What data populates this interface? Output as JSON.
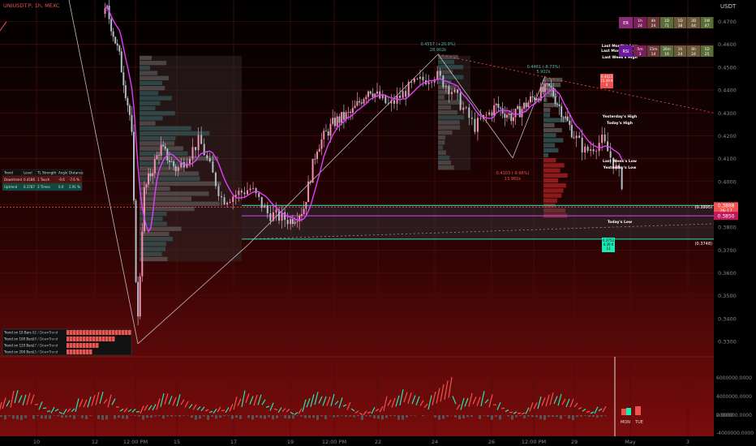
{
  "header": {
    "symbol": "UNIUSDT.P, 1h, MEXC"
  },
  "price_axis": {
    "currency": "USDT",
    "ticks": [
      "0.4700",
      "0.4600",
      "0.4500",
      "0.4400",
      "0.4300",
      "0.4200",
      "0.4100",
      "0.4000",
      "0.3900",
      "0.3800",
      "0.3700",
      "0.3600",
      "0.3500",
      "0.3400",
      "0.3300"
    ],
    "current_price": "0.3888",
    "countdown": "26:17",
    "marker_price": "0.3850"
  },
  "volume_axis": {
    "ticks": [
      "6000000.0000",
      "4000000.0000",
      "2000000.0000",
      "0.0000",
      "-4000000.0000"
    ]
  },
  "time_axis": {
    "labels": [
      "10",
      "12",
      "12:00 PM",
      "15",
      "17",
      "19",
      "12:00 PM",
      "22",
      "24",
      "26",
      "12:00 PM",
      "29",
      "May",
      "3"
    ]
  },
  "tf_tables": {
    "trend_row": {
      "label": "ER",
      "cells": [
        "1h 24",
        "4h 24",
        "1D 71",
        "1D 38",
        "3D 44",
        "1W 47"
      ]
    },
    "rsi_row": {
      "label": "RSI",
      "cells": [
        "5m 3",
        "15m 14",
        "30m 16",
        "1h 24",
        "4h 24",
        "1D 25"
      ]
    }
  },
  "levels": {
    "last_month_low": "Last Month's Low",
    "last_month_high": "Last Month's High",
    "last_week_high": "Last Week's High",
    "yesterday_high": "Yesterday's High",
    "today_high": "Today's High",
    "last_week_low": "Last Week's Low",
    "yesterday_low": "Yesterday's Low",
    "today_low": "Today's Low",
    "zone_top": "(0.3895)",
    "zone_bottom": "(0.3748)"
  },
  "annotations": {
    "peak1_price": "0.4557 (+20.9%)",
    "peak1_vol": "28.902k",
    "peak2_price": "0.4461 (-8.73%)",
    "peak2_vol": "5.902k",
    "trough_price": "0.4103 (-9.96%)",
    "trough_vol": "13.981k",
    "red_box": [
      "0.4413",
      "15.49 K",
      "6"
    ],
    "green_box": [
      "0.3752",
      "4.39 K",
      "13"
    ]
  },
  "trend_table": {
    "headers": [
      "Trend",
      "Level",
      "TL Strength",
      "Angle",
      "Distance"
    ],
    "rows": [
      [
        "Downtrend",
        "0.4186",
        "1 Touch",
        "-0.6",
        "-7.6 %"
      ],
      [
        "Uptrend",
        "0.3787",
        "3 Times",
        "0.0",
        "2.91 %"
      ]
    ]
  },
  "bars_table": {
    "rows": [
      [
        "Trend on 10 Bars",
        "82 / DownTrend"
      ],
      [
        "Trend on 100 Bars",
        "20 / DownTrend"
      ],
      [
        "Trend on 120 Bars",
        "17 / DownTrend"
      ],
      [
        "Trend on 200 Bars",
        "15 / DownTrend"
      ]
    ]
  },
  "day_labels": [
    "MON",
    "TUE"
  ],
  "colors": {
    "bull": "#26a69a",
    "bear": "#ef5350",
    "ma": "#e040fb",
    "accent_teal": "#1de9b6",
    "grid": "#4a0f0f"
  },
  "chart_data": {
    "type": "candlestick",
    "symbol": "UNIUSDT.P",
    "interval": "1h",
    "x_labels": [
      "10",
      "12",
      "12:00 PM",
      "15",
      "17",
      "19",
      "12:00 PM",
      "22",
      "24",
      "26",
      "12:00 PM",
      "29",
      "May",
      "3"
    ],
    "y_ticks": [
      0.47,
      0.46,
      0.45,
      0.44,
      0.43,
      0.42,
      0.41,
      0.4,
      0.39,
      0.38,
      0.37,
      0.36,
      0.35,
      0.34,
      0.33
    ],
    "ylim": [
      0.324,
      0.478
    ],
    "close_path": [
      {
        "x": 0.0,
        "y": 0.485
      },
      {
        "x": 0.5,
        "y": 0.475
      },
      {
        "x": 1.0,
        "y": 0.465
      },
      {
        "x": 1.3,
        "y": 0.475
      },
      {
        "x": 1.6,
        "y": 0.455
      },
      {
        "x": 1.9,
        "y": 0.425
      },
      {
        "x": 2.05,
        "y": 0.335
      },
      {
        "x": 2.2,
        "y": 0.395
      },
      {
        "x": 2.6,
        "y": 0.415
      },
      {
        "x": 3.0,
        "y": 0.405
      },
      {
        "x": 3.4,
        "y": 0.418
      },
      {
        "x": 3.8,
        "y": 0.392
      },
      {
        "x": 4.3,
        "y": 0.397
      },
      {
        "x": 4.6,
        "y": 0.386
      },
      {
        "x": 5.0,
        "y": 0.383
      },
      {
        "x": 5.3,
        "y": 0.388
      },
      {
        "x": 5.6,
        "y": 0.415
      },
      {
        "x": 6.0,
        "y": 0.426
      },
      {
        "x": 6.4,
        "y": 0.43
      },
      {
        "x": 6.8,
        "y": 0.441
      },
      {
        "x": 7.2,
        "y": 0.433
      },
      {
        "x": 7.6,
        "y": 0.442
      },
      {
        "x": 8.0,
        "y": 0.447
      },
      {
        "x": 8.3,
        "y": 0.44
      },
      {
        "x": 8.7,
        "y": 0.424
      },
      {
        "x": 9.1,
        "y": 0.433
      },
      {
        "x": 9.5,
        "y": 0.428
      },
      {
        "x": 10.0,
        "y": 0.437
      },
      {
        "x": 10.4,
        "y": 0.441
      },
      {
        "x": 10.8,
        "y": 0.427
      },
      {
        "x": 11.2,
        "y": 0.413
      },
      {
        "x": 11.5,
        "y": 0.418
      },
      {
        "x": 11.8,
        "y": 0.403
      },
      {
        "x": 12.0,
        "y": 0.388
      }
    ],
    "volume_series": [
      {
        "name": "bull",
        "color": "#26a69a"
      },
      {
        "name": "bear",
        "color": "#ef5350"
      }
    ]
  }
}
